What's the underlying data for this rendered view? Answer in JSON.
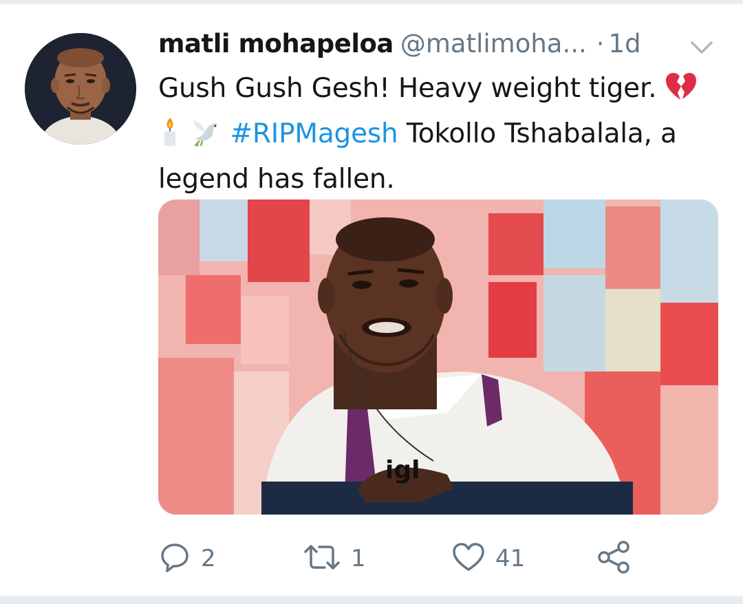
{
  "tweet": {
    "author": {
      "display_name": "matli mohapeloa",
      "handle": "@matlimoha...",
      "avatar_icon": "profile-photo"
    },
    "separator": "·",
    "timestamp": "1d",
    "text": {
      "line1": "Gush Gush Gesh! Heavy weight tiger.",
      "hashtag": "#RIPMagesh",
      "after_hashtag": "Tokollo Tshabalala, a",
      "line3": "legend has fallen."
    },
    "emojis": [
      "broken-heart-icon",
      "candle-icon",
      "dove-icon"
    ],
    "media": {
      "type": "photo"
    },
    "actions": {
      "replies": "2",
      "retweets": "1",
      "likes": "41"
    },
    "colors": {
      "link": "#1b95e0",
      "secondary_text": "#657786",
      "primary_text": "#14171a",
      "broken_heart": "#dd2e44"
    }
  }
}
